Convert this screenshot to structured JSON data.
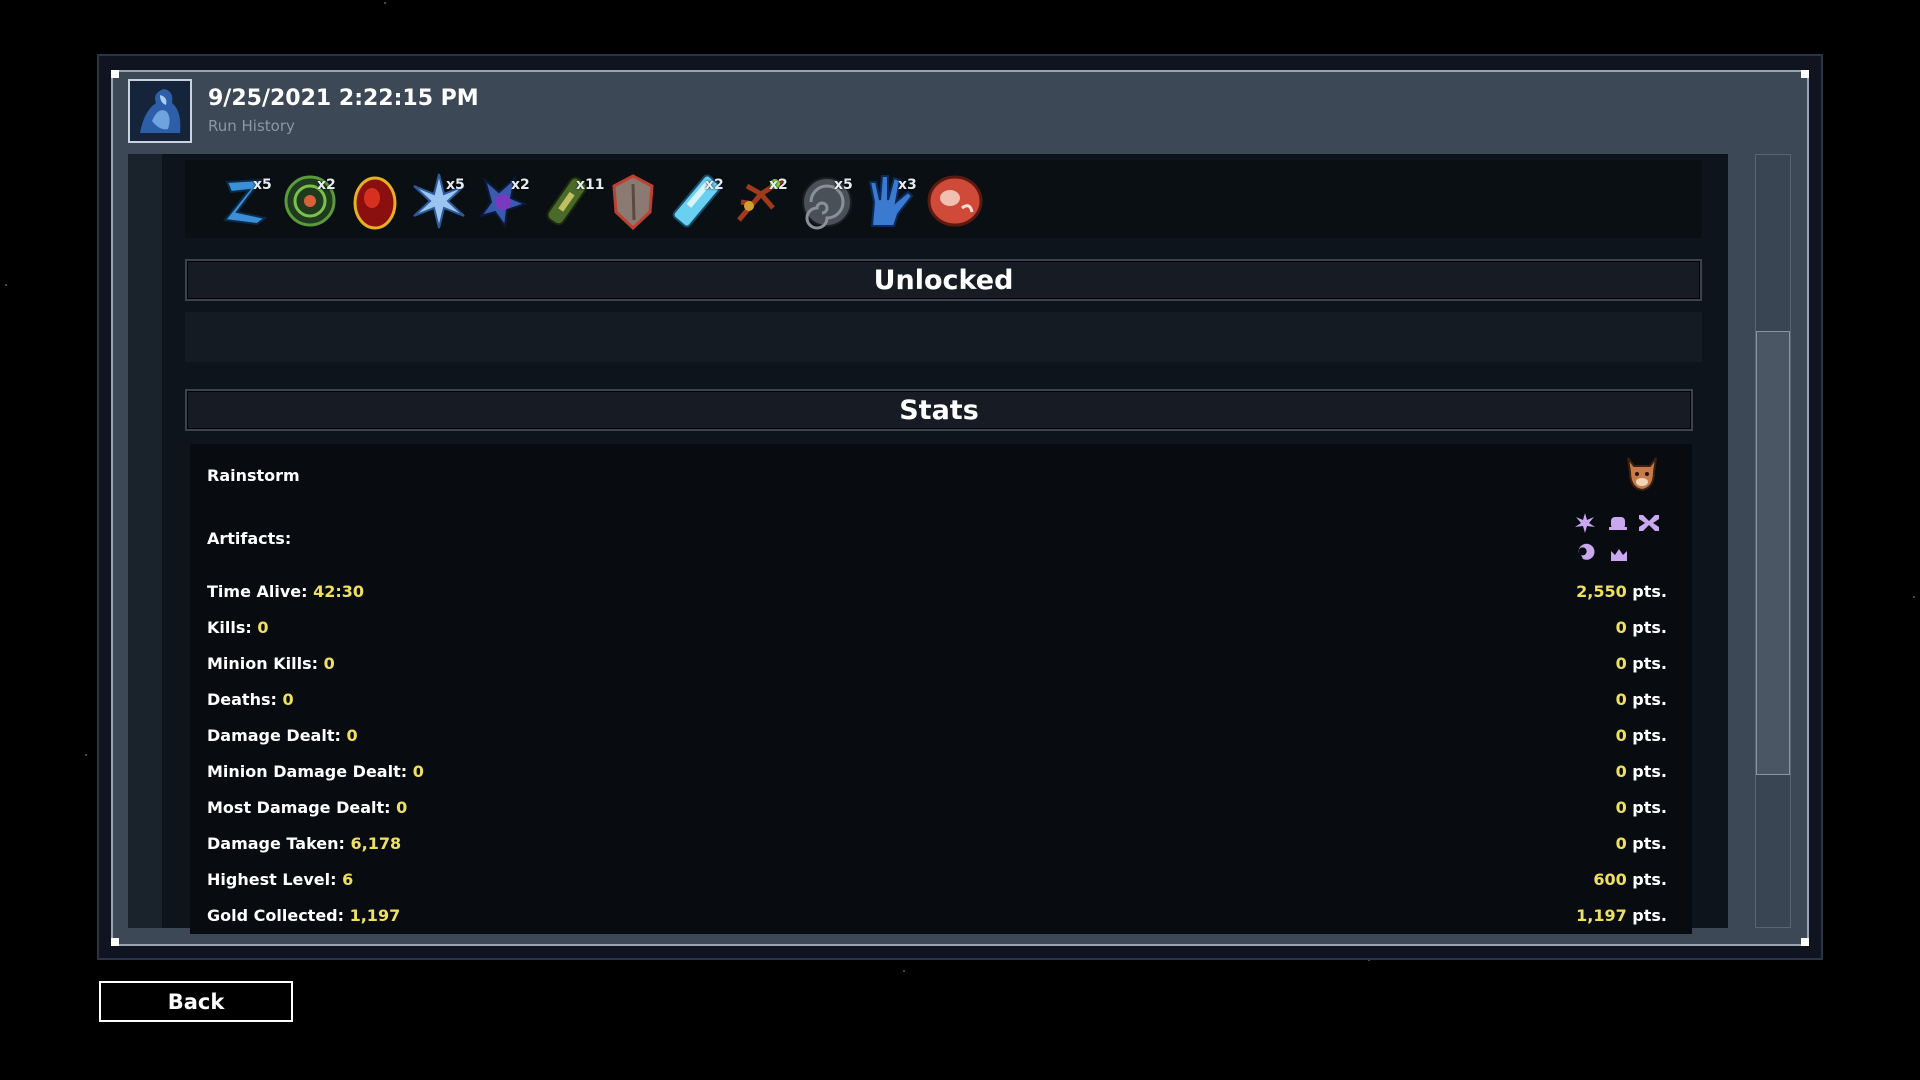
{
  "header": {
    "title": "9/25/2021 2:22:15 PM",
    "subtitle": "Run History"
  },
  "items": [
    {
      "icon": "blue-z-glyph-icon",
      "count": "x5"
    },
    {
      "icon": "green-spiral-icon",
      "count": "x2"
    },
    {
      "icon": "red-egg-icon",
      "count": ""
    },
    {
      "icon": "ice-star-icon",
      "count": "x5"
    },
    {
      "icon": "purple-claw-icon",
      "count": "x2"
    },
    {
      "icon": "green-tube-icon",
      "count": "x11"
    },
    {
      "icon": "stone-shield-icon",
      "count": ""
    },
    {
      "icon": "crystal-vial-icon",
      "count": "x2"
    },
    {
      "icon": "thorn-branch-icon",
      "count": "x2"
    },
    {
      "icon": "fossil-shell-icon",
      "count": "x5"
    },
    {
      "icon": "blue-hand-icon",
      "count": "x3"
    },
    {
      "icon": "meat-steak-icon",
      "count": ""
    }
  ],
  "sections": {
    "unlocked_title": "Unlocked",
    "stats_title": "Stats"
  },
  "stats": {
    "character": "Rainstorm",
    "artifacts_label": "Artifacts:",
    "rows": [
      {
        "label": "Time Alive:",
        "value": "42:30",
        "pts": "2,550",
        "pts_suffix": "pts."
      },
      {
        "label": "Kills:",
        "value": "0",
        "pts": "0",
        "pts_suffix": "pts."
      },
      {
        "label": "Minion Kills:",
        "value": "0",
        "pts": "0",
        "pts_suffix": "pts."
      },
      {
        "label": "Deaths:",
        "value": "0",
        "pts": "0",
        "pts_suffix": "pts."
      },
      {
        "label": "Damage Dealt:",
        "value": "0",
        "pts": "0",
        "pts_suffix": "pts."
      },
      {
        "label": "Minion Damage Dealt:",
        "value": "0",
        "pts": "0",
        "pts_suffix": "pts."
      },
      {
        "label": "Most Damage Dealt:",
        "value": "0",
        "pts": "0",
        "pts_suffix": "pts."
      },
      {
        "label": "Damage Taken:",
        "value": "6,178",
        "pts": "0",
        "pts_suffix": "pts."
      },
      {
        "label": "Highest Level:",
        "value": "6",
        "pts": "600",
        "pts_suffix": "pts."
      },
      {
        "label": "Gold Collected:",
        "value": "1,197",
        "pts": "1,197",
        "pts_suffix": "pts."
      }
    ]
  },
  "footer": {
    "back_label": "Back"
  },
  "colors": {
    "value_yellow": "#f0e060",
    "panel": "#3d4856",
    "background": "#000000"
  }
}
